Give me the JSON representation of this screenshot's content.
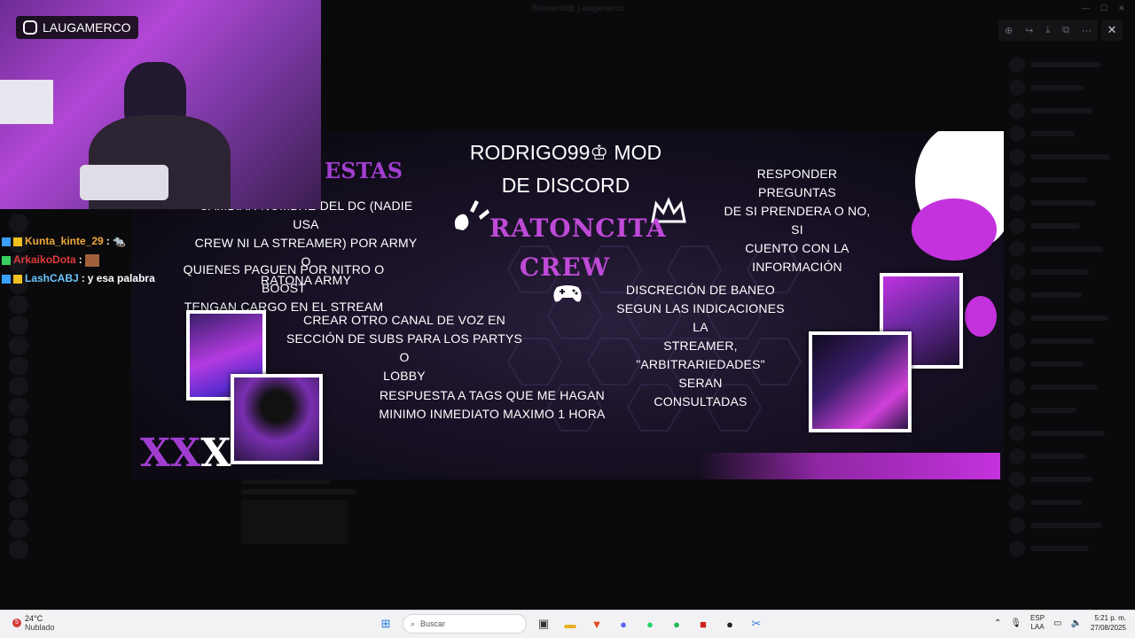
{
  "window": {
    "title": "Bienvenid@ | laugamerco"
  },
  "viewer": {
    "tools": [
      "zoom-in-icon",
      "share-icon",
      "download-icon",
      "open-external-icon",
      "more-icon"
    ],
    "close_label": "✕"
  },
  "banner": {
    "section_partial": "ESTAS",
    "title_line1": "RODRIGO99♔ MOD",
    "title_line2": "DE DISCORD",
    "ratoncita_line1": "RATONCITA",
    "ratoncita_line2": "CREW",
    "left_rule1_line1": "CAMBIAR NOMBRE DEL DC (NADIE USA",
    "left_rule1_line2": "CREW NI LA STREAMER) POR ARMY O",
    "left_rule1_line3": "RATONA ARMY",
    "left_rule2_line1": "QUIENES PAGUEN POR NITRO O BOOST",
    "left_rule2_line2": "TENGAN CARGO EN EL STREAM",
    "center_rule1_line1": "CREAR OTRO CANAL DE VOZ EN",
    "center_rule1_line2": "SECCIÓN DE SUBS PARA LOS PARTYS O",
    "center_rule1_line3": "LOBBY",
    "center_rule2_line1": "RESPUESTA A TAGS QUE ME HAGAN",
    "center_rule2_line2": "MINIMO INMEDIATO MAXIMO 1 HORA",
    "right_rule1_line1": "RESPONDER PREGUNTAS",
    "right_rule1_line2": "DE SI PRENDERA O NO, SI",
    "right_rule1_line3": "CUENTO CON LA",
    "right_rule1_line4": "INFORMACIÓN",
    "right_rule2_line1": "DISCRECIÓN DE BANEO",
    "right_rule2_line2": "SEGUN LAS INDICACIONES LA",
    "right_rule2_line3": "STREAMER,",
    "right_rule2_line4": "\"ARBITRARIEDADES\" SERAN",
    "right_rule2_line5": "CONSULTADAS",
    "xxx_purple": "XX",
    "xxx_white": "X"
  },
  "webcam": {
    "channel_label": "LAUGAMERCO"
  },
  "chat": [
    {
      "user": "Kunta_kinte_29",
      "user_color": "#f2a83a",
      "message": ""
    },
    {
      "user": "ArkaikoDota",
      "user_color": "#e03a3a",
      "message": ""
    },
    {
      "user": "LashCABJ",
      "user_color": "#6ec4ff",
      "message": " y esa palabra"
    }
  ],
  "taskbar": {
    "weather_badge": "5",
    "temperature": "24°C",
    "condition": "Nublado",
    "search_label": "Buscar",
    "lang_line1": "ESP",
    "lang_line2": "LAA",
    "time": "5:21 p. m.",
    "date": "27/08/2025"
  }
}
